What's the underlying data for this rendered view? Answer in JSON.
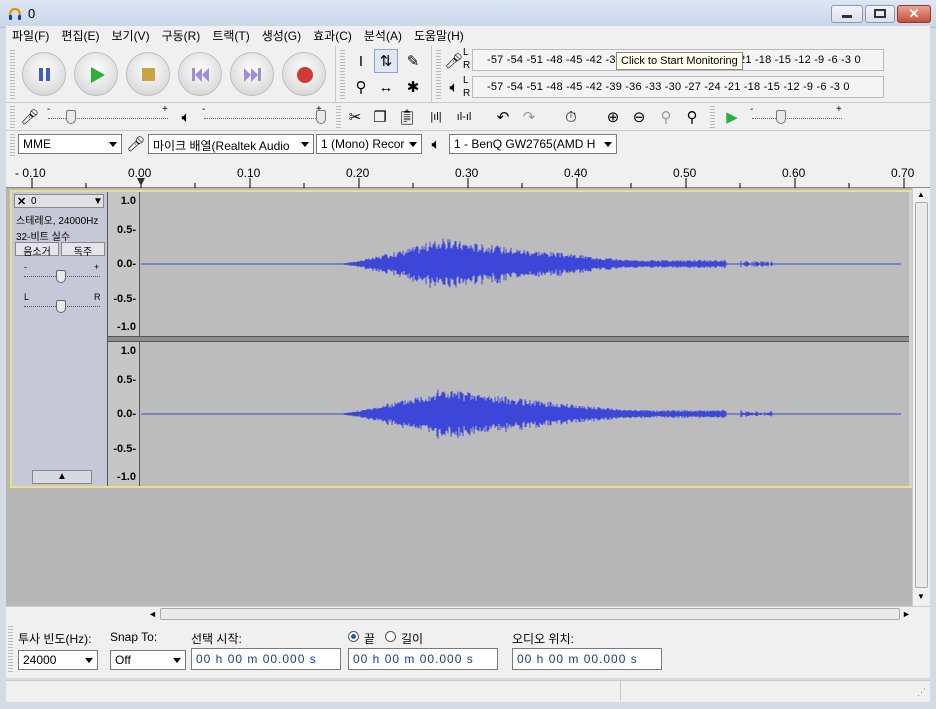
{
  "window": {
    "title": "0"
  },
  "menu": [
    "파일(F)",
    "편집(E)",
    "보기(V)",
    "구동(R)",
    "트랙(T)",
    "생성(G)",
    "효과(C)",
    "분석(A)",
    "도움말(H)"
  ],
  "meters": {
    "record_scale": "-57 -54 -51 -48 -45 -42 -3",
    "record_scale_tail": "21 -18 -15 -12  -9  -6  -3  0",
    "monitor_tooltip": "Click to Start Monitoring",
    "play_scale": "-57 -54 -51 -48 -45 -42 -39 -36 -33 -30 -27 -24 -21 -18 -15 -12  -9  -6  -3  0",
    "lr_l": "L",
    "lr_r": "R"
  },
  "mixer": {
    "minus": "-",
    "plus": "+"
  },
  "devices": {
    "host": "MME",
    "input": "마이크 배열(Realtek Audio",
    "channels": "1 (Mono) Recor",
    "output": "1 - BenQ GW2765(AMD H"
  },
  "ruler": {
    "ticks": [
      "- 0.10",
      "0.00",
      "0.10",
      "0.20",
      "0.30",
      "0.40",
      "0.50",
      "0.60",
      "0.70"
    ]
  },
  "track": {
    "name": "0",
    "info1": "스테레오, 24000Hz",
    "info2": "32-비트 실수",
    "mute": "음소거",
    "solo": "독주",
    "gain_minus": "-",
    "gain_plus": "+",
    "pan_l": "L",
    "pan_r": "R",
    "scale": [
      "1.0",
      "0.5-",
      "0.0-",
      "-0.5-",
      "-1.0"
    ]
  },
  "bottom": {
    "rate_label": "투사 빈도(Hz):",
    "rate_value": "24000",
    "snap_label": "Snap To:",
    "snap_value": "Off",
    "sel_start_label": "선택 시작:",
    "end_label": "끝",
    "length_label": "길이",
    "audio_pos_label": "오디오 위치:",
    "time_value": "00 h 00 m 00.000 s"
  },
  "colors": {
    "wave": "#3c46d8",
    "accent": "#e8e08c"
  }
}
